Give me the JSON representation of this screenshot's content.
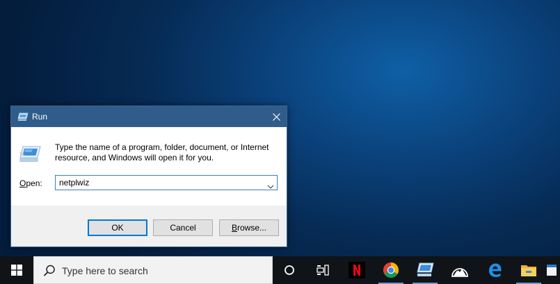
{
  "dialog": {
    "title": "Run",
    "description": "Type the name of a program, folder, document, or Internet resource, and Windows will open it for you.",
    "open_label_mnemonic": "O",
    "open_label_rest": "pen:",
    "open_value": "netplwiz",
    "ok_label": "OK",
    "cancel_label": "Cancel",
    "browse_label_mnemonic": "B",
    "browse_label_rest": "rowse..."
  },
  "taskbar": {
    "search_placeholder": "Type here to search",
    "apps": [
      {
        "icon": "cortana-circle-icon"
      },
      {
        "icon": "task-view-icon"
      },
      {
        "icon": "netflix-icon",
        "letter": "N"
      },
      {
        "icon": "chrome-icon"
      },
      {
        "icon": "run-app-icon"
      },
      {
        "icon": "mountain-app-icon"
      },
      {
        "icon": "edge-icon",
        "letter": "e"
      },
      {
        "icon": "file-explorer-icon"
      }
    ]
  },
  "colors": {
    "titlebar": "#2f5c8a",
    "accent": "#0078d7",
    "taskbar": "#101418",
    "netflix": "#e50914"
  }
}
